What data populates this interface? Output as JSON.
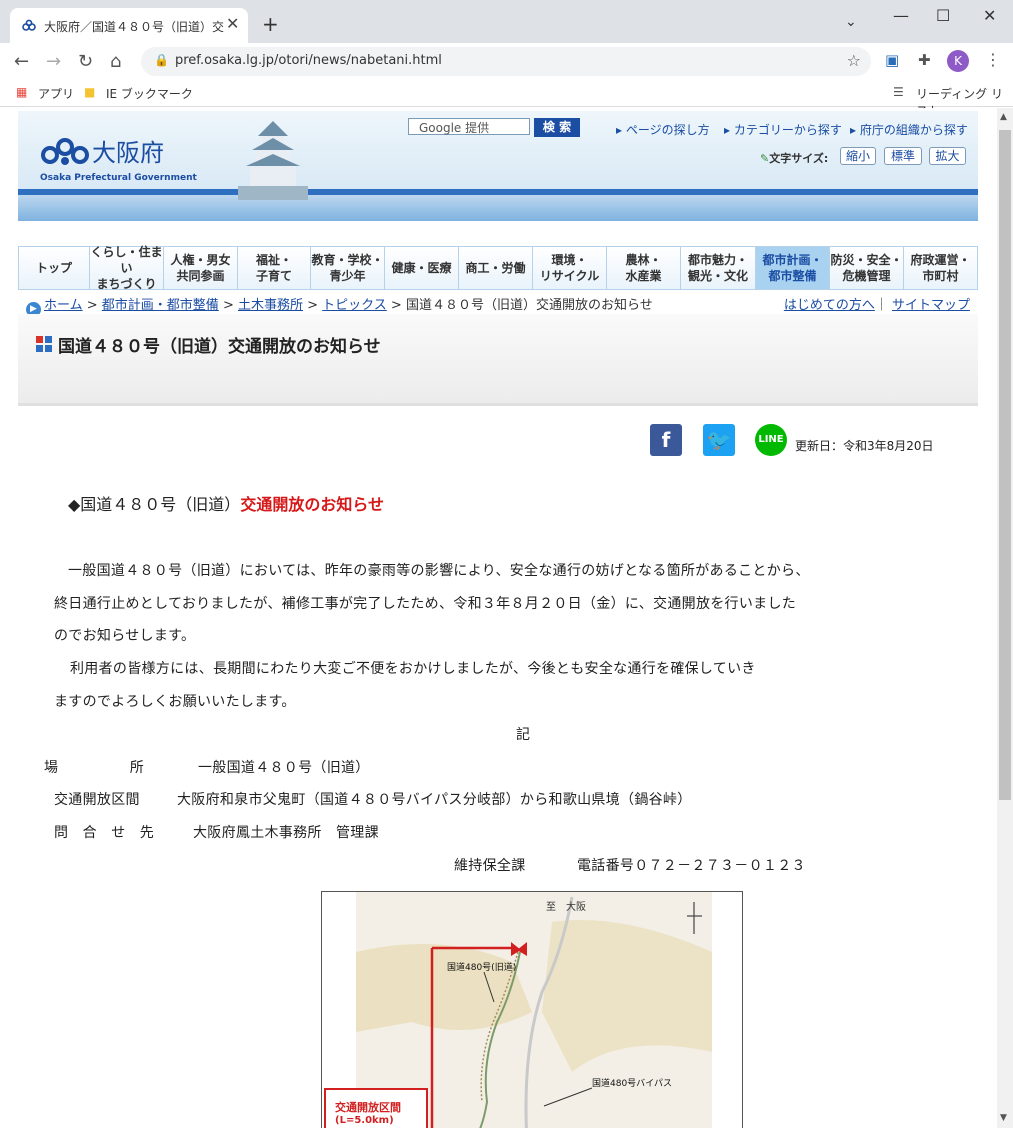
{
  "browser": {
    "tab_title": "大阪府／国道４８０号（旧道）交",
    "url": "pref.osaka.lg.jp/otori/news/nabetani.html",
    "bookmarks": [
      "アプリ",
      "IE ブックマーク"
    ],
    "reading_list": "リーディング リスト",
    "avatar": "K"
  },
  "header": {
    "logo_name": "大阪府",
    "logo_en": "Osaka Prefectural Government",
    "search_placeholder": "Google 提供",
    "search_button": "検 索",
    "links": [
      "ページの探し方",
      "カテゴリーから探す",
      "府庁の組織から探す"
    ],
    "font_size_label": "文字サイズ:",
    "font_buttons": [
      "縮小",
      "標準",
      "拡大"
    ]
  },
  "gnav": [
    {
      "l1": "トップ",
      "l2": ""
    },
    {
      "l1": "くらし・住まい",
      "l2": "まちづくり"
    },
    {
      "l1": "人権・男女",
      "l2": "共同参画"
    },
    {
      "l1": "福祉・",
      "l2": "子育て"
    },
    {
      "l1": "教育・学校・",
      "l2": "青少年"
    },
    {
      "l1": "健康・医療",
      "l2": ""
    },
    {
      "l1": "商工・労働",
      "l2": ""
    },
    {
      "l1": "環境・",
      "l2": "リサイクル"
    },
    {
      "l1": "農林・",
      "l2": "水産業"
    },
    {
      "l1": "都市魅力・",
      "l2": "観光・文化"
    },
    {
      "l1": "都市計画・",
      "l2": "都市整備"
    },
    {
      "l1": "防災・安全・",
      "l2": "危機管理"
    },
    {
      "l1": "府政運営・",
      "l2": "市町村"
    }
  ],
  "breadcrumb": {
    "items": [
      "ホーム",
      "都市計画・都市整備",
      "土木事務所",
      "トピックス"
    ],
    "current": "国道４８０号（旧道）交通開放のお知らせ",
    "first_time": "はじめての方へ",
    "sitemap": "サイトマップ"
  },
  "page_title": "国道４８０号（旧道）交通開放のお知らせ",
  "updated": "更新日：令和3年8月20日",
  "headline": {
    "prefix": "◆国道４８０号（旧道）",
    "emph": "交通開放のお知らせ"
  },
  "body": [
    "一般国道４８０号（旧道）においては、昨年の豪雨等の影響により、安全な通行の妨げとなる箇所があることから、",
    "終日通行止めとしておりましたが、補修工事が完了したため、令和３年８月２０日（金）に、交通開放を行いました",
    "のでお知らせします。",
    "利用者の皆様方には、長期間にわたり大変ご不便をおかけしましたが、今後とも安全な通行を確保していき",
    "ますのでよろしくお願いいたします。"
  ],
  "ki": "記",
  "details": {
    "place_label": "場　　　　　所",
    "place_value": "一般国道４８０号（旧道）",
    "section_label": "交通開放区間",
    "section_value": "大阪府和泉市父鬼町（国道４８０号バイパス分岐部）から和歌山県境（鍋谷峠）",
    "contact_label": "問　合　せ　先",
    "contact_value": "大阪府鳳土木事務所　管理課",
    "contact_dept": "維持保全課",
    "contact_phone": "電話番号０７２－２７３－０１２３"
  },
  "map": {
    "north_label": "至　大阪",
    "old_road_label": "国道480号(旧道)",
    "bypass_label": "国道480号バイパス",
    "section_box": "交通開放区間",
    "section_length": "(L=5.0km)"
  },
  "colors": {
    "accent": "#1b4da3",
    "headline_red": "#d61818",
    "facebook": "#3b5998",
    "twitter": "#1da1f2",
    "line": "#00b900"
  }
}
